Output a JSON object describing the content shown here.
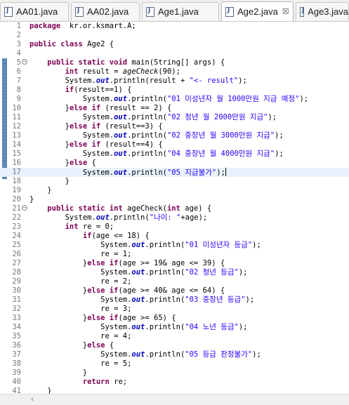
{
  "tabs": [
    {
      "label": "AA01.java",
      "active": false
    },
    {
      "label": "AA02.java",
      "active": false
    },
    {
      "label": "Age1.java",
      "active": false
    },
    {
      "label": "Age2.java",
      "active": true,
      "close": "☒"
    },
    {
      "label": "Age3.java",
      "active": false
    }
  ],
  "icons": {
    "java_file": "java-file-icon",
    "fold": "⊖"
  },
  "colors": {
    "keyword": "#7f0055",
    "string": "#2a00ff",
    "field": "#0000c0",
    "line_highlight": "#e8f2fe"
  },
  "editor": {
    "current_line": 17,
    "lines": [
      {
        "n": "1",
        "segs": [
          [
            "kw",
            "package"
          ],
          [
            "",
            "  kr.or.ksmart.A;"
          ]
        ]
      },
      {
        "n": "2",
        "segs": []
      },
      {
        "n": "3",
        "segs": [
          [
            "kw",
            "public class"
          ],
          [
            "",
            " Age2 {"
          ]
        ]
      },
      {
        "n": "4",
        "segs": []
      },
      {
        "n": "5",
        "fold": true,
        "segs": [
          [
            "",
            "    "
          ],
          [
            "kw",
            "public static void"
          ],
          [
            "",
            " main(String[] args) {"
          ]
        ]
      },
      {
        "n": "6",
        "segs": [
          [
            "",
            "        "
          ],
          [
            "kw",
            "int"
          ],
          [
            "",
            " result = "
          ],
          [
            "mi",
            "ageCheck"
          ],
          [
            "",
            "(90);"
          ]
        ]
      },
      {
        "n": "7",
        "segs": [
          [
            "",
            "        System."
          ],
          [
            "fi",
            "out"
          ],
          [
            "",
            ".println(result + "
          ],
          [
            "st",
            "\"<- result\""
          ],
          [
            "",
            ");"
          ]
        ]
      },
      {
        "n": "8",
        "segs": [
          [
            "",
            "        "
          ],
          [
            "kw",
            "if"
          ],
          [
            "",
            "(result==1) {"
          ]
        ]
      },
      {
        "n": "9",
        "segs": [
          [
            "",
            "            System."
          ],
          [
            "fi",
            "out"
          ],
          [
            "",
            ".println("
          ],
          [
            "st",
            "\"01 미성년자 월 1000만원 지급 예정\""
          ],
          [
            "",
            ");"
          ]
        ]
      },
      {
        "n": "10",
        "segs": [
          [
            "",
            "        }"
          ],
          [
            "kw",
            "else if"
          ],
          [
            "",
            " (result == 2) {"
          ]
        ]
      },
      {
        "n": "11",
        "segs": [
          [
            "",
            "            System."
          ],
          [
            "fi",
            "out"
          ],
          [
            "",
            ".println("
          ],
          [
            "st",
            "\"02 청년 월 2000만원 지급\""
          ],
          [
            "",
            ");"
          ]
        ]
      },
      {
        "n": "12",
        "segs": [
          [
            "",
            "        }"
          ],
          [
            "kw",
            "else if"
          ],
          [
            "",
            " (result==3) {"
          ]
        ]
      },
      {
        "n": "13",
        "segs": [
          [
            "",
            "            System."
          ],
          [
            "fi",
            "out"
          ],
          [
            "",
            ".println("
          ],
          [
            "st",
            "\"02 중장년 월 3000만원 지급\""
          ],
          [
            "",
            ");"
          ]
        ]
      },
      {
        "n": "14",
        "segs": [
          [
            "",
            "        }"
          ],
          [
            "kw",
            "else if"
          ],
          [
            "",
            " (result==4) {"
          ]
        ]
      },
      {
        "n": "15",
        "segs": [
          [
            "",
            "            System."
          ],
          [
            "fi",
            "out"
          ],
          [
            "",
            ".println("
          ],
          [
            "st",
            "\"04 중장년 월 4000만원 지급\""
          ],
          [
            "",
            ");"
          ]
        ]
      },
      {
        "n": "16",
        "segs": [
          [
            "",
            "        }"
          ],
          [
            "kw",
            "else"
          ],
          [
            "",
            " {"
          ]
        ]
      },
      {
        "n": "17",
        "segs": [
          [
            "",
            "            System."
          ],
          [
            "fi",
            "out"
          ],
          [
            "",
            ".println("
          ],
          [
            "st",
            "\"05 지급불가\""
          ],
          [
            "",
            ");"
          ]
        ]
      },
      {
        "n": "18",
        "segs": [
          [
            "",
            "        }"
          ]
        ]
      },
      {
        "n": "19",
        "segs": [
          [
            "",
            "    }"
          ]
        ]
      },
      {
        "n": "20",
        "segs": [
          [
            "",
            "}"
          ]
        ]
      },
      {
        "n": "21",
        "fold": true,
        "segs": [
          [
            "",
            "    "
          ],
          [
            "kw",
            "public static int"
          ],
          [
            "",
            " ageCheck("
          ],
          [
            "kw",
            "int"
          ],
          [
            "",
            " age) {"
          ]
        ]
      },
      {
        "n": "22",
        "segs": [
          [
            "",
            "        System."
          ],
          [
            "fi",
            "out"
          ],
          [
            "",
            ".println("
          ],
          [
            "st",
            "\"나이: \""
          ],
          [
            "",
            "+age);"
          ]
        ]
      },
      {
        "n": "23",
        "segs": [
          [
            "",
            "        "
          ],
          [
            "kw",
            "int"
          ],
          [
            "",
            " re = 0;"
          ]
        ]
      },
      {
        "n": "24",
        "segs": [
          [
            "",
            "            "
          ],
          [
            "kw",
            "if"
          ],
          [
            "",
            "(age <= 18) {"
          ]
        ]
      },
      {
        "n": "25",
        "segs": [
          [
            "",
            "                System."
          ],
          [
            "fi",
            "out"
          ],
          [
            "",
            ".println("
          ],
          [
            "st",
            "\"01 미성년자 등급\""
          ],
          [
            "",
            ");"
          ]
        ]
      },
      {
        "n": "26",
        "segs": [
          [
            "",
            "                re = 1;"
          ]
        ]
      },
      {
        "n": "27",
        "segs": [
          [
            "",
            "            }"
          ],
          [
            "kw",
            "else if"
          ],
          [
            "",
            "(age >= 19& age <= 39) {"
          ]
        ]
      },
      {
        "n": "28",
        "segs": [
          [
            "",
            "                System."
          ],
          [
            "fi",
            "out"
          ],
          [
            "",
            ".println("
          ],
          [
            "st",
            "\"02 청년 등급\""
          ],
          [
            "",
            ");"
          ]
        ]
      },
      {
        "n": "29",
        "segs": [
          [
            "",
            "                re = 2;"
          ]
        ]
      },
      {
        "n": "30",
        "segs": [
          [
            "",
            "            }"
          ],
          [
            "kw",
            "else if"
          ],
          [
            "",
            "(age >= 40& age <= 64) {"
          ]
        ]
      },
      {
        "n": "31",
        "segs": [
          [
            "",
            "                System."
          ],
          [
            "fi",
            "out"
          ],
          [
            "",
            ".println("
          ],
          [
            "st",
            "\"03 중장년 등급\""
          ],
          [
            "",
            ");"
          ]
        ]
      },
      {
        "n": "32",
        "segs": [
          [
            "",
            "                re = 3;"
          ]
        ]
      },
      {
        "n": "33",
        "segs": [
          [
            "",
            "            }"
          ],
          [
            "kw",
            "else if"
          ],
          [
            "",
            "(age >= 65) {"
          ]
        ]
      },
      {
        "n": "34",
        "segs": [
          [
            "",
            "                System."
          ],
          [
            "fi",
            "out"
          ],
          [
            "",
            ".println("
          ],
          [
            "st",
            "\"04 노년 등급\""
          ],
          [
            "",
            ");"
          ]
        ]
      },
      {
        "n": "35",
        "segs": [
          [
            "",
            "                re = 4;"
          ]
        ]
      },
      {
        "n": "36",
        "segs": [
          [
            "",
            "            }"
          ],
          [
            "kw",
            "else"
          ],
          [
            "",
            " {"
          ]
        ]
      },
      {
        "n": "37",
        "segs": [
          [
            "",
            "                System."
          ],
          [
            "fi",
            "out"
          ],
          [
            "",
            ".println("
          ],
          [
            "st",
            "\"05 등급 판정불가\""
          ],
          [
            "",
            ");"
          ]
        ]
      },
      {
        "n": "38",
        "segs": [
          [
            "",
            "                re = 5;"
          ]
        ]
      },
      {
        "n": "39",
        "segs": [
          [
            "",
            "            }"
          ]
        ]
      },
      {
        "n": "40",
        "segs": [
          [
            "",
            "            "
          ],
          [
            "kw",
            "return"
          ],
          [
            "",
            " re;"
          ]
        ]
      },
      {
        "n": "41",
        "segs": [
          [
            "",
            "    }"
          ]
        ]
      }
    ]
  }
}
